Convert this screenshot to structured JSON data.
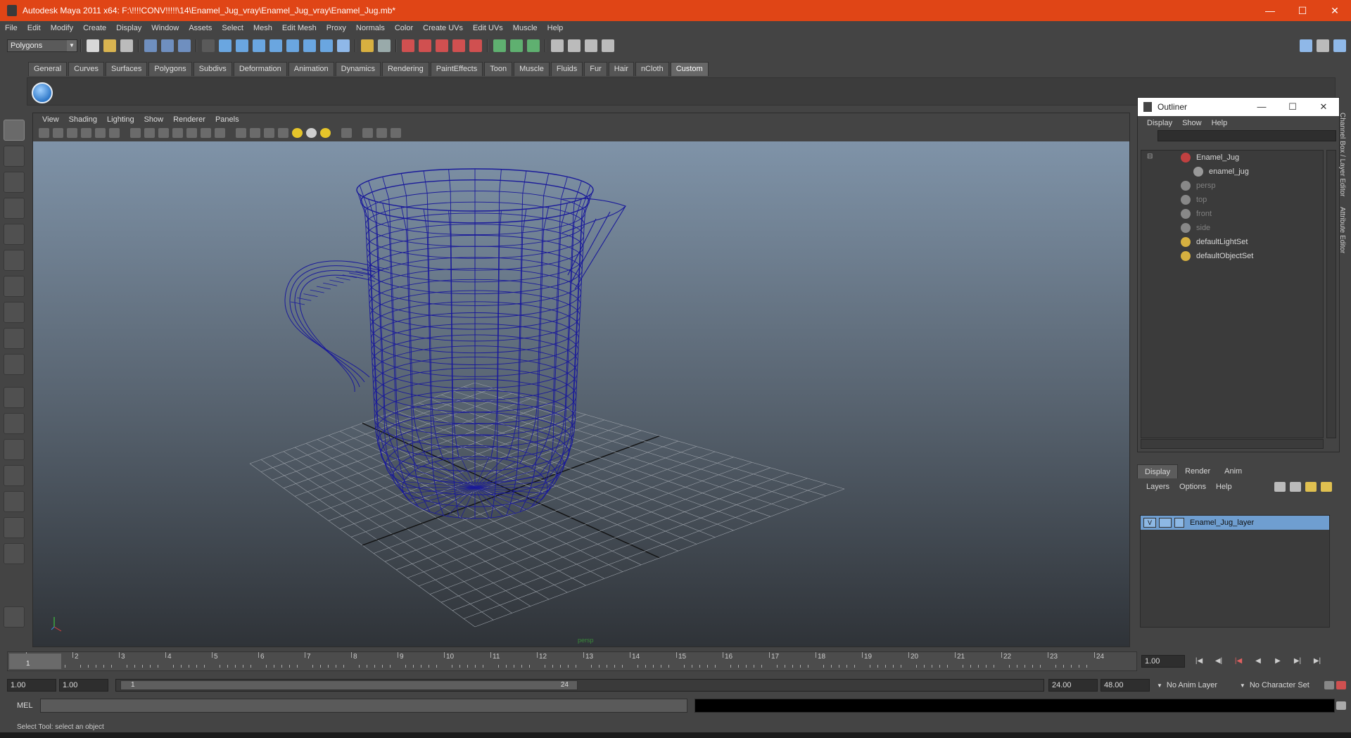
{
  "window": {
    "title": "Autodesk Maya 2011 x64: F:\\!!!!CONV!!!!!\\14\\Enamel_Jug_vray\\Enamel_Jug_vray\\Enamel_Jug.mb*",
    "minimize": "—",
    "maximize": "☐",
    "close": "✕"
  },
  "menubar": [
    "File",
    "Edit",
    "Modify",
    "Create",
    "Display",
    "Window",
    "Assets",
    "Select",
    "Mesh",
    "Edit Mesh",
    "Proxy",
    "Normals",
    "Color",
    "Create UVs",
    "Edit UVs",
    "Muscle",
    "Help"
  ],
  "toolbar": {
    "mode": "Polygons"
  },
  "shelf_tabs": [
    "General",
    "Curves",
    "Surfaces",
    "Polygons",
    "Subdivs",
    "Deformation",
    "Animation",
    "Dynamics",
    "Rendering",
    "PaintEffects",
    "Toon",
    "Muscle",
    "Fluids",
    "Fur",
    "Hair",
    "nCloth",
    "Custom"
  ],
  "shelf_active": "Custom",
  "panel_menu": [
    "View",
    "Shading",
    "Lighting",
    "Show",
    "Renderer",
    "Panels"
  ],
  "viewport": {
    "camera_label": "persp",
    "wire_color": "#1a1a9a"
  },
  "outliner": {
    "title": "Outliner",
    "menu": [
      "Display",
      "Show",
      "Help"
    ],
    "items": [
      {
        "label": "Enamel_Jug",
        "dim": false
      },
      {
        "label": "enamel_jug",
        "dim": false
      },
      {
        "label": "persp",
        "dim": true
      },
      {
        "label": "top",
        "dim": true
      },
      {
        "label": "front",
        "dim": true
      },
      {
        "label": "side",
        "dim": true
      },
      {
        "label": "defaultLightSet",
        "dim": false
      },
      {
        "label": "defaultObjectSet",
        "dim": false
      }
    ]
  },
  "side_tabs": [
    "Channel Box / Layer Editor",
    "Attribute Editor"
  ],
  "layer_editor": {
    "tabs": [
      "Display",
      "Render",
      "Anim"
    ],
    "menu": [
      "Layers",
      "Options",
      "Help"
    ],
    "layer": {
      "visible": "V",
      "name": "Enamel_Jug_layer"
    }
  },
  "timeslider": {
    "ticks": [
      "1",
      "2",
      "3",
      "4",
      "5",
      "6",
      "7",
      "8",
      "9",
      "10",
      "11",
      "12",
      "13",
      "14",
      "15",
      "16",
      "17",
      "18",
      "19",
      "20",
      "21",
      "22",
      "23",
      "24"
    ],
    "current_frame": "1",
    "current_time_field": "1.00"
  },
  "range": {
    "start": "1.00",
    "anim_start": "1.00",
    "range_start_label": "1",
    "range_end_label": "24",
    "anim_end": "24.00",
    "end": "48.00",
    "anim_layer": "No Anim Layer",
    "character_set": "No Character Set"
  },
  "mel": {
    "label": "MEL"
  },
  "status": {
    "text": "Select Tool: select an object"
  }
}
